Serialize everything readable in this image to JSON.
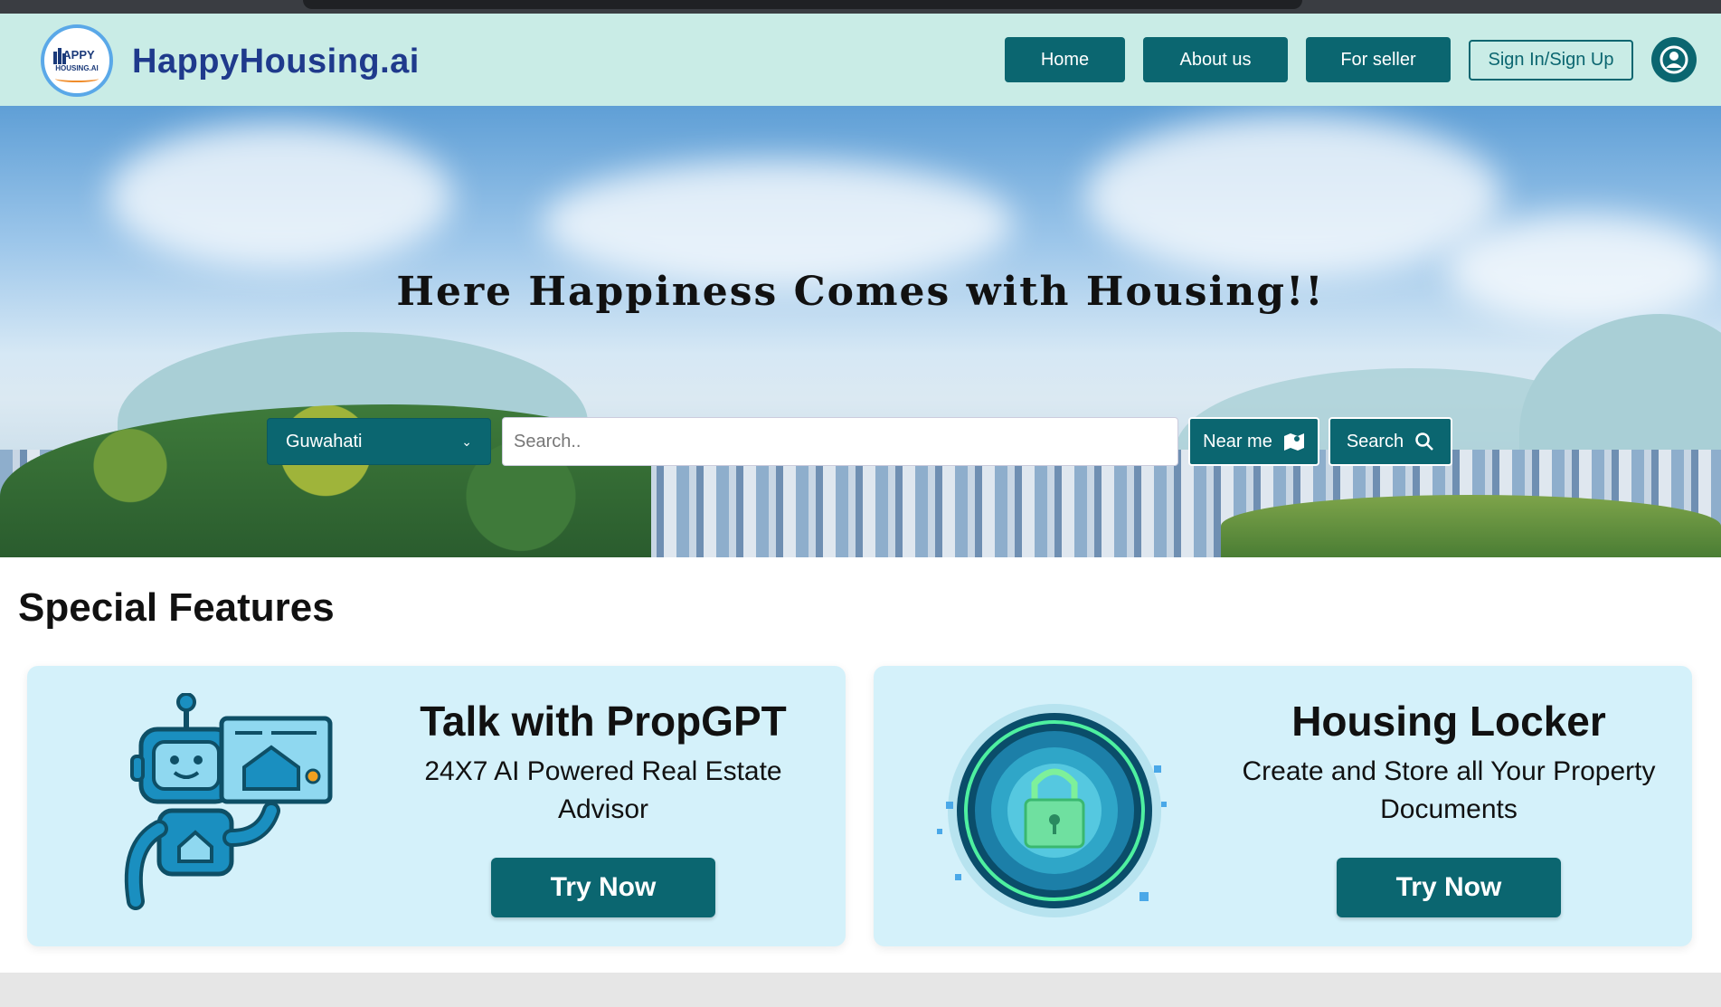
{
  "header": {
    "brand": "HappyHousing.ai",
    "logo_text_top": "APPY",
    "logo_text_bottom": "HOUSING.AI",
    "nav": {
      "home": "Home",
      "about": "About us",
      "seller": "For seller",
      "sign_in": "Sign In/Sign Up"
    },
    "user_icon": "user-circle-icon"
  },
  "hero": {
    "tagline": "Here Happiness Comes with Housing!!",
    "city_selected": "Guwahati",
    "search_placeholder": "Search..",
    "near_me_label": "Near me",
    "near_me_icon": "map-icon",
    "search_label": "Search",
    "search_icon": "search-icon"
  },
  "features": {
    "title": "Special Features",
    "cards": [
      {
        "title": "Talk with PropGPT",
        "description": "24X7 AI Powered Real Estate Advisor",
        "button": "Try Now",
        "illustration": "robot-house-icon"
      },
      {
        "title": "Housing Locker",
        "description": "Create and Store all Your Property Documents",
        "button": "Try Now",
        "illustration": "digital-lock-icon"
      }
    ]
  },
  "colors": {
    "primary": "#0b6670",
    "header_bg": "#c9ece6",
    "brand_text": "#1f3a8c",
    "card_bg": "#d4f1fa"
  }
}
